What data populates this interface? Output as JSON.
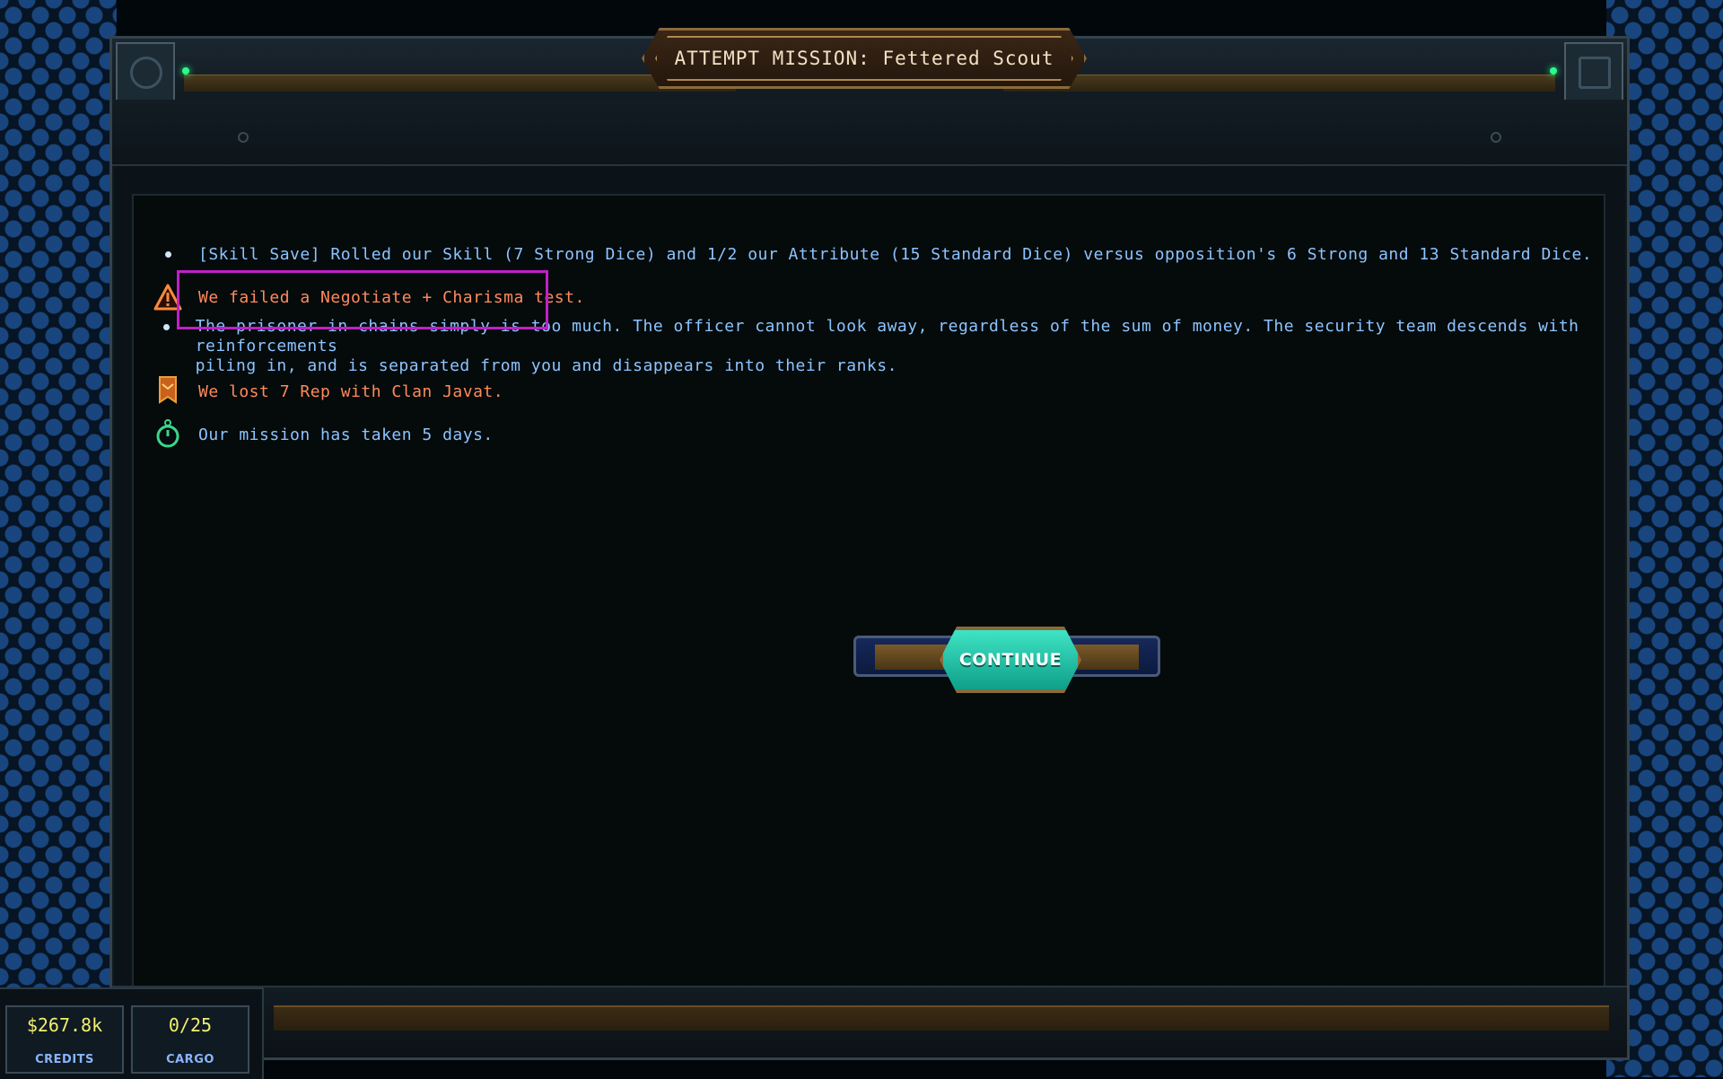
{
  "window": {
    "title": "ATTEMPT MISSION: Fettered Scout"
  },
  "log": [
    {
      "icon": "bullet-dot",
      "text": "[Skill Save] Rolled our Skill (7 Strong Dice) and 1/2 our Attribute (15 Standard Dice) versus opposition's 6 Strong and 13 Standard Dice.",
      "color": "#8cc4ff"
    },
    {
      "icon": "warning-triangle-icon",
      "text": "We failed a Negotiate + Charisma test.",
      "color": "#ff8a5c"
    },
    {
      "icon": "bullet-dot",
      "line1": "The prisoner in chains simply is too much. The officer cannot look away, regardless of the sum of money. The security team descends with reinforcements",
      "line2": "piling in, and  is separated from you and disappears into their ranks.",
      "color": "#8cc4ff"
    },
    {
      "icon": "reputation-banner-icon",
      "text": "We lost 7 Rep with Clan Javat.",
      "color": "#ff8a5c"
    },
    {
      "icon": "stopwatch-icon",
      "text": "Our mission has taken 5 days.",
      "color": "#8cc4ff"
    }
  ],
  "continue": {
    "label": "CONTINUE"
  },
  "hud": {
    "credits_value": "$267.8k",
    "credits_label": "CREDITS",
    "cargo_value": "0/25",
    "cargo_label": "CARGO"
  },
  "colors": {
    "accent_teal": "#2fd6b8",
    "highlight": "#c020c8",
    "gold_trim": "#8a6a3a"
  }
}
